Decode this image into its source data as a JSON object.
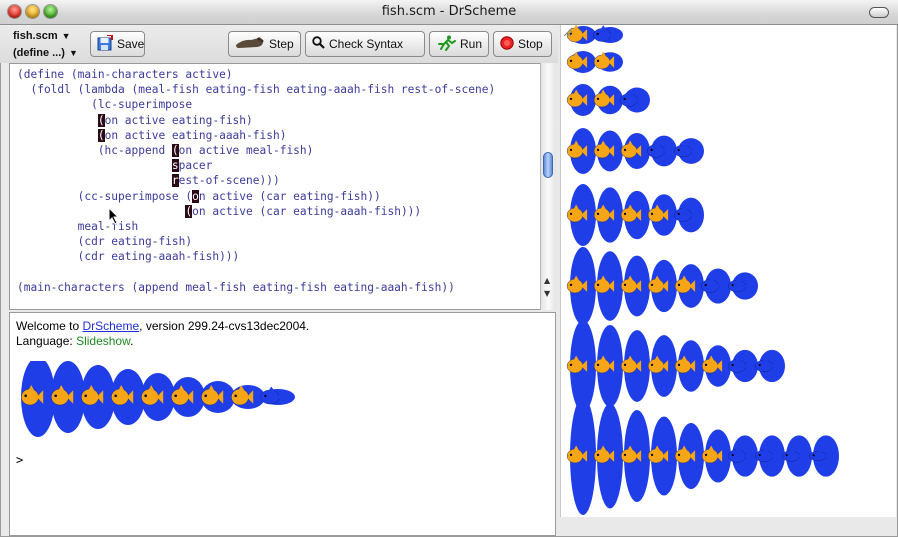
{
  "window": {
    "title": "fish.scm - DrScheme"
  },
  "toolbar": {
    "file_popup": "fish.scm",
    "define_popup": "(define ...)",
    "save_label": "Save",
    "step_label": "Step",
    "check_syntax_label": "Check Syntax",
    "run_label": "Run",
    "stop_label": "Stop"
  },
  "definitions": {
    "code": [
      "(define (main-characters active)",
      "  (foldl (lambda (meal-fish eating-fish eating-aaah-fish rest-of-scene)",
      "           (lc-superimpose",
      "            (on active eating-fish)",
      "            (on active eating-aaah-fish)",
      "            (hc-append (on active meal-fish)",
      "                       spacer",
      "                       rest-of-scene)))",
      "         (cc-superimpose (on active (car eating-fish))",
      "                         (on active (car eating-aaah-fish)))",
      "         meal-fish",
      "         (cdr eating-fish)",
      "         (cdr eating-aaah-fish)))",
      "",
      "(main-characters (append meal-fish eating-fish eating-aaah-fish))"
    ]
  },
  "interactions": {
    "welcome_prefix": "Welcome to ",
    "welcome_link": "DrScheme",
    "welcome_suffix": ", version 299.24-cvs13dec2004.",
    "language_prefix": "Language: ",
    "language_name": "Slideshow",
    "language_suffix": ".",
    "prompt": ">"
  },
  "stage": {
    "rows": [
      {
        "orange": 1,
        "blue": 1
      },
      {
        "orange": 2,
        "blue": 0
      },
      {
        "orange": 2,
        "blue": 1
      },
      {
        "orange": 3,
        "blue": 2
      },
      {
        "orange": 4,
        "blue": 1
      },
      {
        "orange": 5,
        "blue": 2
      },
      {
        "orange": 6,
        "blue": 2
      },
      {
        "orange": 6,
        "blue": 4
      }
    ]
  },
  "colors": {
    "fish_orange": "#f5a516",
    "fish_blue": "#1f3ee8",
    "code_text": "#3b3b9b",
    "link": "#1f2fd8",
    "language": "#1f8a1f"
  },
  "icons": [
    "save-icon",
    "step-icon",
    "check-syntax-icon",
    "run-icon",
    "stop-icon",
    "mouse-cursor-icon",
    "resize-grip-icon"
  ]
}
